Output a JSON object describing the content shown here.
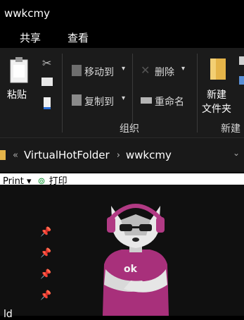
{
  "window": {
    "title": "wwkcmy"
  },
  "menu": {
    "tabs": [
      "共享",
      "查看"
    ]
  },
  "ribbon": {
    "paste_label": "粘贴",
    "move_to_label": "移动到",
    "copy_to_label": "复制到",
    "delete_label": "删除",
    "rename_label": "重命名",
    "new_folder_line1": "新建",
    "new_folder_line2": "文件夹",
    "group_organize": "组织",
    "group_new": "新建"
  },
  "address": {
    "chevron": "«",
    "crumbs": [
      "VirtualHotFolder",
      "wwkcmy"
    ],
    "separator": "›"
  },
  "strip": {
    "print_label": "Print ▾",
    "print_cn": "打印"
  },
  "nav": {
    "partial_text": "ld"
  },
  "colors": {
    "accent_folder": "#e5b449",
    "shirt": "#a8307b",
    "headphones": "#b13a84"
  }
}
